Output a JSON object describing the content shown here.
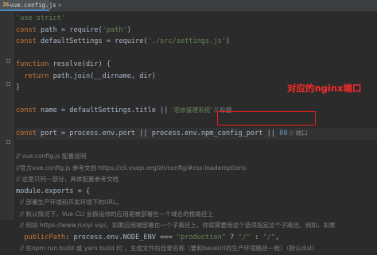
{
  "tab": {
    "icon": "JS",
    "label": "vue.config.js",
    "close": "×"
  },
  "code_lines": [
    {
      "segments": [
        {
          "t": "'use strict'",
          "c": "str"
        }
      ]
    },
    {
      "segments": [
        {
          "t": "const ",
          "c": "kw"
        },
        {
          "t": "path = require(",
          "c": ""
        },
        {
          "t": "'path'",
          "c": "str"
        },
        {
          "t": ")",
          "c": ""
        }
      ]
    },
    {
      "segments": [
        {
          "t": "const ",
          "c": "kw"
        },
        {
          "t": "defaultSettings = require(",
          "c": ""
        },
        {
          "t": "'./src/settings.js'",
          "c": "str"
        },
        {
          "t": ")",
          "c": ""
        }
      ]
    },
    {
      "segments": []
    },
    {
      "segments": [
        {
          "t": "function ",
          "c": "kw"
        },
        {
          "t": "resolve(dir) {",
          "c": ""
        }
      ]
    },
    {
      "segments": [
        {
          "t": "  ",
          "c": "guide"
        },
        {
          "t": "return ",
          "c": "kw"
        },
        {
          "t": "path.join(__dirname, dir)",
          "c": ""
        }
      ]
    },
    {
      "segments": [
        {
          "t": "}",
          "c": ""
        }
      ]
    },
    {
      "segments": []
    },
    {
      "segments": [
        {
          "t": "const ",
          "c": "kw"
        },
        {
          "t": "name = defaultSettings.title || ",
          "c": ""
        },
        {
          "t": "'若依管理系统'",
          "c": "str cjk"
        },
        {
          "t": " // 标题",
          "c": "cmt cjk"
        }
      ]
    },
    {
      "segments": []
    },
    {
      "segments": [
        {
          "t": "const ",
          "c": "kw"
        },
        {
          "t": "port = process.env.port || process.env.npm_config_port || ",
          "c": ""
        },
        {
          "t": "80",
          "c": "num"
        },
        {
          "t": " // 端口",
          "c": "cmt cjk"
        }
      ]
    },
    {
      "segments": []
    },
    {
      "segments": [
        {
          "t": "// vue.config.js 配置说明",
          "c": "cmt cjk"
        }
      ]
    },
    {
      "segments": [
        {
          "t": "//官方vue.config.js 参考文档 https://cli.vuejs.org/zh/config/#css-loaderoptions",
          "c": "cmt cjk"
        }
      ]
    },
    {
      "segments": [
        {
          "t": "// 这里只列一部分，具体配置参考文档",
          "c": "cmt cjk"
        }
      ]
    },
    {
      "segments": [
        {
          "t": "module.exports = {",
          "c": ""
        }
      ]
    },
    {
      "segments": [
        {
          "t": "  // 部署生产环境和开发环境下的URL。",
          "c": "cmt cjk"
        }
      ]
    },
    {
      "segments": [
        {
          "t": "  // 默认情况下，Vue CLI 会假设你的应用是被部署在一个域名的根路径上",
          "c": "cmt cjk"
        }
      ]
    },
    {
      "segments": [
        {
          "t": "  // 例如 https://www.ruoyi.vip/。如果应用被部署在一个子路径上，你就需要用这个选项指定这个子路径。例如，如果",
          "c": "cmt cjk"
        }
      ]
    },
    {
      "segments": [
        {
          "t": "  ",
          "c": ""
        },
        {
          "t": "publicPath",
          "c": "kw"
        },
        {
          "t": ": process.env.NODE_ENV === ",
          "c": ""
        },
        {
          "t": "\"production\"",
          "c": "str"
        },
        {
          "t": " ? ",
          "c": ""
        },
        {
          "t": "\"/\"",
          "c": "str"
        },
        {
          "t": " : ",
          "c": ""
        },
        {
          "t": "\"/\"",
          "c": "str"
        },
        {
          "t": ",",
          "c": ""
        }
      ]
    },
    {
      "segments": [
        {
          "t": "  // 在npm run build 或 yarn build 时 ，生成文件的目录名称（要和baseUrl的生产环境路径一致）（默认dist）",
          "c": "cmt cjk"
        }
      ]
    }
  ],
  "annotation": {
    "label": "对应的nginx端口",
    "color": "#e5201b"
  },
  "colors": {
    "background": "#2b2b2b",
    "keyword": "#cc7832",
    "string": "#6a8759",
    "number": "#6897bb",
    "comment": "#808080"
  }
}
